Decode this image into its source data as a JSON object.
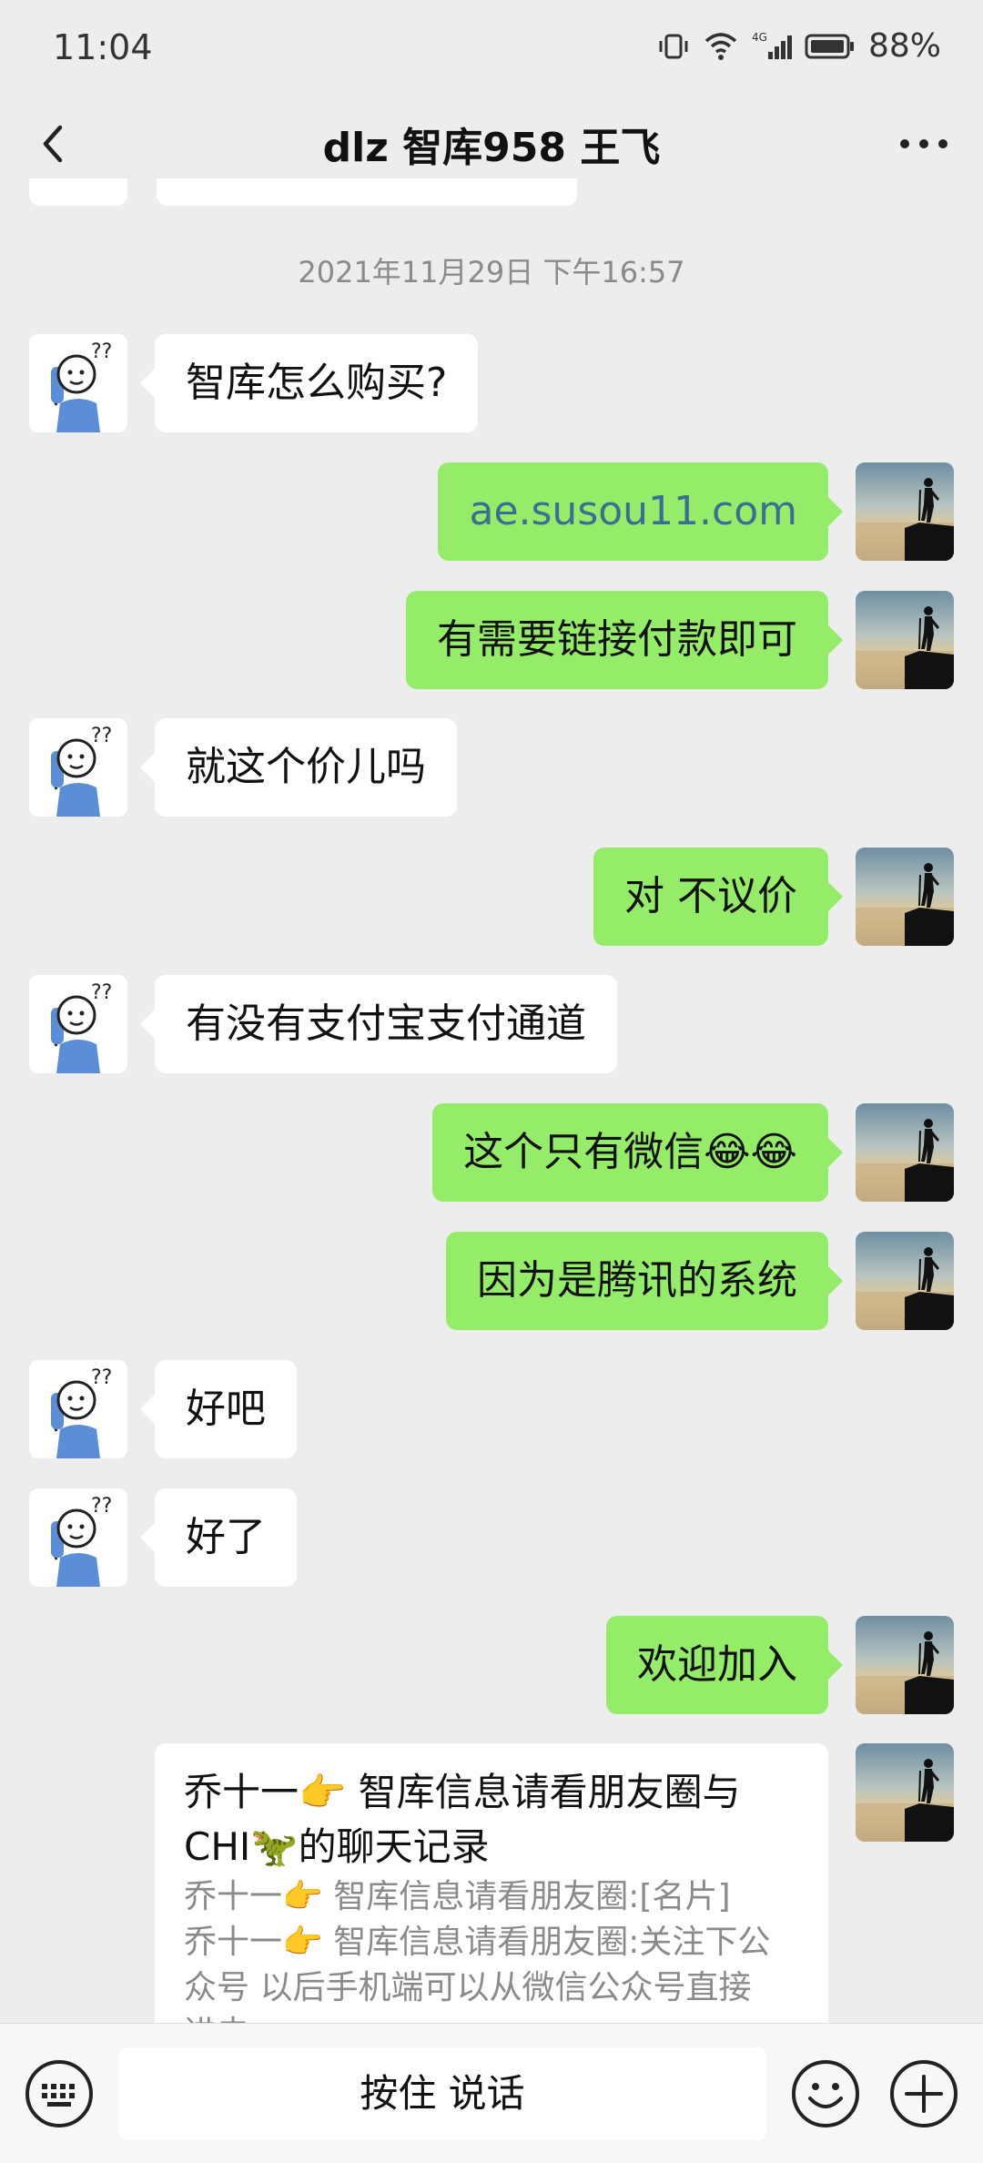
{
  "status": {
    "time": "11:04",
    "battery": "88%",
    "network": "4G"
  },
  "header": {
    "title": "dlz 智库958 王飞"
  },
  "chat": {
    "timestamp": "2021年11月29日 下午16:57",
    "messages": [
      {
        "side": "recv",
        "text": "智库怎么购买?"
      },
      {
        "side": "sent",
        "text": "ae.susou11.com"
      },
      {
        "side": "sent",
        "text": "有需要链接付款即可"
      },
      {
        "side": "recv",
        "text": "就这个价儿吗"
      },
      {
        "side": "sent",
        "text": "对 不议价"
      },
      {
        "side": "recv",
        "text": "有没有支付宝支付通道"
      },
      {
        "side": "sent",
        "text": "这个只有微信😂😂"
      },
      {
        "side": "sent",
        "text": "因为是腾讯的系统"
      },
      {
        "side": "recv",
        "text": "好吧"
      },
      {
        "side": "recv",
        "text": "好了"
      },
      {
        "side": "sent",
        "text": "欢迎加入"
      }
    ],
    "forwarded": {
      "title_line1": "乔十一👉 智库信息请看朋友圈与",
      "title_line2": "CHI🦖的聊天记录",
      "line1": "乔十一👉 智库信息请看朋友圈:[名片]",
      "line2": "乔十一👉 智库信息请看朋友圈:关注下公",
      "line3": "众号 以后手机端可以从微信公众号直接",
      "line4": "进去"
    }
  },
  "input": {
    "voice_label": "按住 说话"
  },
  "icons": {
    "back": "chevron-left-icon",
    "more": "more-dots-icon",
    "keyboard": "keyboard-icon",
    "emoji": "emoji-icon",
    "plus": "plus-icon"
  },
  "colors": {
    "sent_bubble": "#95ec69",
    "recv_bubble": "#ffffff",
    "background": "#ededed",
    "link": "#3a6f94"
  }
}
